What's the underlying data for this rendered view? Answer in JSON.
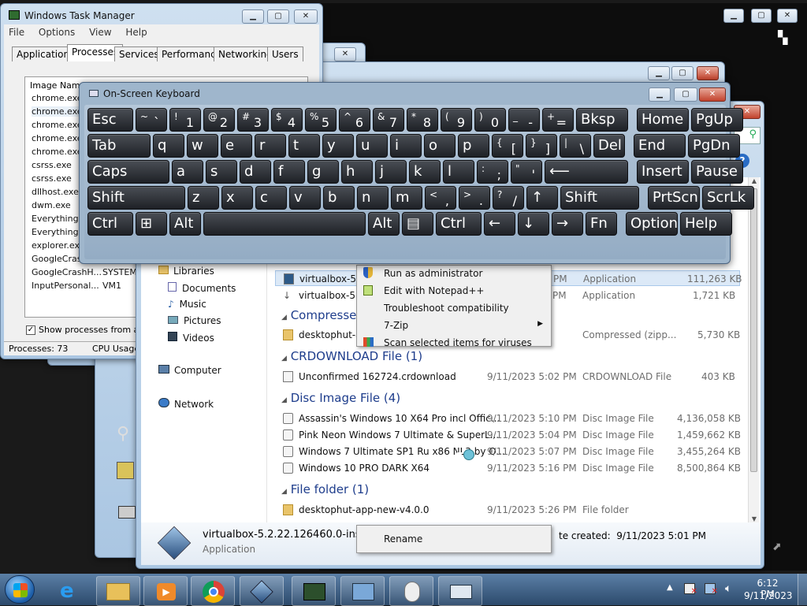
{
  "task_manager": {
    "title": "Windows Task Manager",
    "menu": [
      "File",
      "Options",
      "View",
      "Help"
    ],
    "tabs": [
      "Applications",
      "Processes",
      "Services",
      "Performance",
      "Networking",
      "Users"
    ],
    "column_header": "Image Name",
    "processes": [
      "chrome.exe",
      "chrome.exe",
      "chrome.exe",
      "chrome.exe",
      "chrome.exe",
      "csrss.exe",
      "csrss.exe",
      "dllhost.exe",
      "dwm.exe",
      "Everything.e",
      "Everything.e",
      "explorer.exe",
      "GoogleCrash",
      "GoogleCrashH...",
      "InputPersonal..."
    ],
    "users": {
      "13": "SYSTEM",
      "14": "VM1"
    },
    "show_all_label": "Show processes from all u",
    "status_processes": "Processes: 73",
    "status_cpu": "CPU Usage"
  },
  "keyboard": {
    "title": "On-Screen Keyboard",
    "rows": [
      [
        {
          "m": "Esc"
        },
        {
          "s": "~",
          "m": "`"
        },
        {
          "s": "!",
          "m": "1"
        },
        {
          "s": "@",
          "m": "2"
        },
        {
          "s": "#",
          "m": "3"
        },
        {
          "s": "$",
          "m": "4"
        },
        {
          "s": "%",
          "m": "5"
        },
        {
          "s": "^",
          "m": "6"
        },
        {
          "s": "&",
          "m": "7"
        },
        {
          "s": "*",
          "m": "8"
        },
        {
          "s": "(",
          "m": "9"
        },
        {
          "s": ")",
          "m": "0"
        },
        {
          "s": "_",
          "m": "-"
        },
        {
          "s": "+",
          "m": "="
        },
        {
          "m": "Bksp"
        },
        {
          "m": "Home"
        },
        {
          "m": "PgUp"
        }
      ],
      [
        {
          "m": "Tab"
        },
        {
          "m": "q"
        },
        {
          "m": "w"
        },
        {
          "m": "e"
        },
        {
          "m": "r"
        },
        {
          "m": "t"
        },
        {
          "m": "y"
        },
        {
          "m": "u"
        },
        {
          "m": "i"
        },
        {
          "m": "o"
        },
        {
          "m": "p"
        },
        {
          "s": "{",
          "m": "["
        },
        {
          "s": "}",
          "m": "]"
        },
        {
          "s": "|",
          "m": "\\"
        },
        {
          "m": "Del"
        },
        {
          "m": "End"
        },
        {
          "m": "PgDn"
        }
      ],
      [
        {
          "m": "Caps"
        },
        {
          "m": "a"
        },
        {
          "m": "s"
        },
        {
          "m": "d"
        },
        {
          "m": "f"
        },
        {
          "m": "g"
        },
        {
          "m": "h"
        },
        {
          "m": "j"
        },
        {
          "m": "k"
        },
        {
          "m": "l"
        },
        {
          "s": ":",
          "m": ";"
        },
        {
          "s": "\"",
          "m": "'"
        },
        {
          "m": "⟵"
        },
        {
          "m": "Insert"
        },
        {
          "m": "Pause"
        }
      ],
      [
        {
          "m": "Shift"
        },
        {
          "m": "z"
        },
        {
          "m": "x"
        },
        {
          "m": "c"
        },
        {
          "m": "v"
        },
        {
          "m": "b"
        },
        {
          "m": "n"
        },
        {
          "m": "m"
        },
        {
          "s": "<",
          "m": ","
        },
        {
          "s": ">",
          "m": "."
        },
        {
          "s": "?",
          "m": "/"
        },
        {
          "m": "↑"
        },
        {
          "m": "Shift"
        },
        {
          "m": "PrtScn"
        },
        {
          "m": "ScrLk"
        }
      ],
      [
        {
          "m": "Ctrl"
        },
        {
          "m": "⊞"
        },
        {
          "m": "Alt"
        },
        {
          "m": ""
        },
        {
          "m": "Alt"
        },
        {
          "m": "▤"
        },
        {
          "m": "Ctrl"
        },
        {
          "m": "←"
        },
        {
          "m": "↓"
        },
        {
          "m": "→"
        },
        {
          "m": "Fn"
        },
        {
          "m": "Options"
        },
        {
          "m": "Help"
        }
      ]
    ]
  },
  "explorer": {
    "nav": [
      "Libraries",
      "Documents",
      "Music",
      "Pictures",
      "Videos",
      "Computer",
      "Network"
    ],
    "rows_top": [
      {
        "name": "virtualbox-5.2",
        "date": "PM",
        "type": "Application",
        "size": "111,263 KB"
      },
      {
        "name": "virtualbox-5.2",
        "date": "PM",
        "type": "Application",
        "size": "1,721 KB"
      }
    ],
    "group_compressed": "Compressed (",
    "row_compressed": {
      "name": "desktophut-ap",
      "type": "Compressed (zipp...",
      "size": "5,730 KB"
    },
    "group_crdownload": "CRDOWNLOAD File (1)",
    "row_crdownload": {
      "name": "Unconfirmed 162724.crdownload",
      "date": "9/11/2023 5:02 PM",
      "type": "CRDOWNLOAD File",
      "size": "403 KB"
    },
    "group_disc": "Disc Image File (4)",
    "rows_disc": [
      {
        "name": "Assassin's Windows 10 X64 Pro incl Offic...",
        "date": "9/11/2023 5:10 PM",
        "type": "Disc Image File",
        "size": "4,136,058 KB"
      },
      {
        "name": "Pink Neon Windows 7 Ultimate & SuperL...",
        "date": "9/11/2023 5:04 PM",
        "type": "Disc Image File",
        "size": "1,459,662 KB"
      },
      {
        "name": "Windows 7 Ultimate SP1 Ru x86 NL3 by O...",
        "date": "9/11/2023 5:07 PM",
        "type": "Disc Image File",
        "size": "3,455,264 KB"
      },
      {
        "name": "Windows 10 PRO DARK X64",
        "date": "9/11/2023 5:16 PM",
        "type": "Disc Image File",
        "size": "8,500,864 KB"
      }
    ],
    "group_folder": "File folder (1)",
    "row_folder": {
      "name": "desktophut-app-new-v4.0.0",
      "date": "9/11/2023 5:26 PM",
      "type": "File folder"
    },
    "details_name": "virtualbox-5.2.22.126460.0-installe",
    "details_type": "Application",
    "details_created": "te created:  9/11/2023 5:01 PM"
  },
  "context_menu": {
    "items": [
      "Run as administrator",
      "Edit with Notepad++",
      "Troubleshoot compatibility",
      "7-Zip",
      "Scan selected items for viruses"
    ],
    "rename": "Rename"
  },
  "taskbar": {
    "time": "6:12 PM",
    "date": "9/11/2023"
  }
}
